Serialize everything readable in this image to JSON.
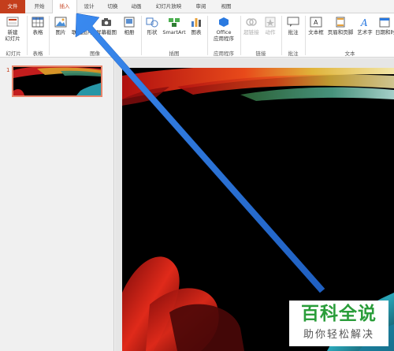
{
  "tabs": [
    "文件",
    "开始",
    "插入",
    "设计",
    "切换",
    "动画",
    "幻灯片放映",
    "审阅",
    "视图"
  ],
  "ribbon": {
    "new_slide": [
      "新建",
      "幻灯片"
    ],
    "table": "表格",
    "picture": "图片",
    "online_picture": "联机图片",
    "screenshot": "屏幕截图",
    "album": "相册",
    "shapes": "形状",
    "smartart": "SmartArt",
    "chart": "图表",
    "office_apps": [
      "Office",
      "应用程序"
    ],
    "hyperlink": "超链接",
    "action": "动作",
    "comment": "批注",
    "textbox": "文本框",
    "header_footer": "页眉和页脚",
    "wordart": "艺术字",
    "datetime": "日期和时"
  },
  "groups": {
    "slides": "幻灯片",
    "tables": "表格",
    "images": "图像",
    "illustrations": "插图",
    "apps": "应用程序",
    "links": "链接",
    "comments": "批注",
    "text": "文本"
  },
  "slide_number": "1",
  "watermark": {
    "title": "百科全说",
    "subtitle": "助你轻松解决"
  },
  "colors": {
    "accent": "#c43e1c",
    "arrow": "#2b7ae0",
    "watermark_green": "#2a9d3a"
  },
  "icons": [
    "new-slide-icon",
    "table-icon",
    "picture-icon",
    "online-picture-icon",
    "screenshot-icon",
    "album-icon",
    "shapes-icon",
    "smartart-icon",
    "chart-icon",
    "office-apps-icon",
    "hyperlink-icon",
    "action-icon",
    "comment-icon",
    "textbox-icon",
    "header-footer-icon",
    "wordart-icon",
    "datetime-icon"
  ]
}
